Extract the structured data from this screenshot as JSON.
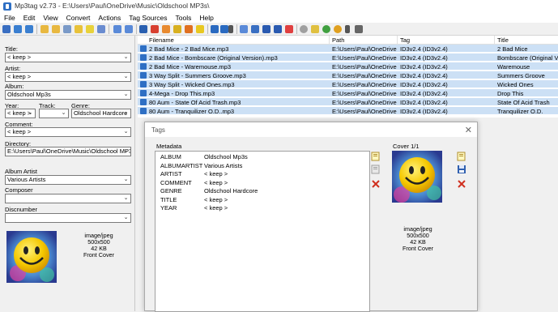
{
  "window": {
    "title": "Mp3tag v2.73  -  E:\\Users\\Paul\\OneDrive\\Music\\Oldschool MP3s\\"
  },
  "menu": [
    "File",
    "Edit",
    "View",
    "Convert",
    "Actions",
    "Tag Sources",
    "Tools",
    "Help"
  ],
  "toolbar": {
    "icons": [
      "save-icon",
      "undo-icon",
      "redo-icon",
      "folder-open-icon",
      "folder-add-icon",
      "playlist-icon",
      "favorites-icon",
      "export-icon",
      "import-icon",
      "tag-filename-icon",
      "filename-tag-icon",
      "text-file-tag-icon",
      "freedb-icon",
      "case-conversion-icon",
      "actions-icon",
      "dropdown-icon",
      "view-icon",
      "grid-icon",
      "filter-icon",
      "columns-icon",
      "tags-icon",
      "track-icon",
      "settings-icon",
      "globe-icon",
      "wrench-icon"
    ]
  },
  "left_panel": {
    "title_label": "Title:",
    "title_value": "< keep >",
    "artist_label": "Artist:",
    "artist_value": "< keep >",
    "album_label": "Album:",
    "album_value": "Oldschool Mp3s",
    "year_label": "Year:",
    "year_value": "< keep >",
    "track_label": "Track:",
    "track_value": "",
    "genre_label": "Genre:",
    "genre_value": "Oldschool Hardcore",
    "comment_label": "Comment:",
    "comment_value": "< keep >",
    "directory_label": "Directory:",
    "directory_value": "E:\\Users\\Paul\\OneDrive\\Music\\Oldschool MP3s",
    "album_artist_label": "Album Artist",
    "album_artist_value": "Various Artists",
    "composer_label": "Composer",
    "composer_value": "",
    "discnumber_label": "Discnumber",
    "discnumber_value": "",
    "cover": {
      "mime": "image/jpeg",
      "dimensions": "500x500",
      "size": "42 KB",
      "type": "Front Cover"
    }
  },
  "file_list": {
    "columns": [
      "Filename",
      "Path",
      "Tag",
      "Title"
    ],
    "rows": [
      {
        "filename": "2 Bad Mice - 2 Bad Mice.mp3",
        "path": "E:\\Users\\Paul\\OneDrive...",
        "tag": "ID3v2.4 (ID3v2.4)",
        "title": "2 Bad Mice"
      },
      {
        "filename": "2 Bad Mice - Bombscare (Original Version).mp3",
        "path": "E:\\Users\\Paul\\OneDrive...",
        "tag": "ID3v2.4 (ID3v2.4)",
        "title": "Bombscare (Original Ver"
      },
      {
        "filename": "2 Bad Mice - Waremouse.mp3",
        "path": "E:\\Users\\Paul\\OneDrive...",
        "tag": "ID3v2.4 (ID3v2.4)",
        "title": "Waremouse"
      },
      {
        "filename": "3 Way Split - Summers Groove.mp3",
        "path": "E:\\Users\\Paul\\OneDrive...",
        "tag": "ID3v2.4 (ID3v2.4)",
        "title": "Summers Groove"
      },
      {
        "filename": "3 Way Split - Wicked Ones.mp3",
        "path": "E:\\Users\\Paul\\OneDrive...",
        "tag": "ID3v2.4 (ID3v2.4)",
        "title": "Wicked Ones"
      },
      {
        "filename": "4-Mega - Drop This.mp3",
        "path": "E:\\Users\\Paul\\OneDrive...",
        "tag": "ID3v2.4 (ID3v2.4)",
        "title": "Drop This"
      },
      {
        "filename": "80 Aum - State Of Acid Trash.mp3",
        "path": "E:\\Users\\Paul\\OneDrive...",
        "tag": "ID3v2.4 (ID3v2.4)",
        "title": "State Of Acid Trash"
      },
      {
        "filename": "80 Aum - Tranquilizer O.D..mp3",
        "path": "E:\\Users\\Paul\\OneDrive...",
        "tag": "ID3v2.4 (ID3v2.4)",
        "title": "Tranquilizer O.D."
      }
    ]
  },
  "dialog": {
    "title": "Tags",
    "metadata_label": "Metadata",
    "cover_label": "Cover 1/1",
    "metadata": [
      {
        "key": "ALBUM",
        "value": "Oldschool Mp3s"
      },
      {
        "key": "ALBUMARTIST",
        "value": "Various Artists"
      },
      {
        "key": "ARTIST",
        "value": "< keep >"
      },
      {
        "key": "COMMENT",
        "value": "< keep >"
      },
      {
        "key": "GENRE",
        "value": "Oldschool Hardcore"
      },
      {
        "key": "TITLE",
        "value": "< keep >"
      },
      {
        "key": "YEAR",
        "value": "< keep >"
      }
    ],
    "cover": {
      "mime": "image/jpeg",
      "dimensions": "500x500",
      "size": "42 KB",
      "type": "Front Cover"
    }
  }
}
